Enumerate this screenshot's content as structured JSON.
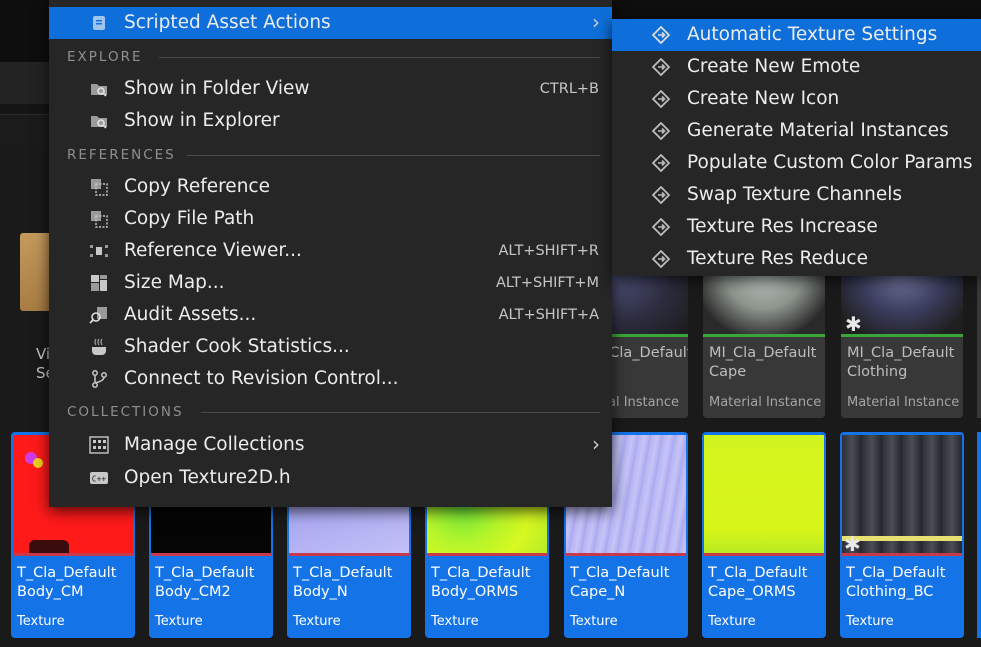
{
  "menu": {
    "scripted": {
      "label": "Scripted Asset Actions",
      "arrow": "›"
    },
    "sections": {
      "explore": "EXPLORE",
      "references": "REFERENCES",
      "collections": "COLLECTIONS"
    },
    "items": {
      "show_folder": {
        "label": "Show in Folder View",
        "shortcut": "CTRL+B"
      },
      "show_explorer": {
        "label": "Show in Explorer"
      },
      "copy_reference": {
        "label": "Copy Reference"
      },
      "copy_file_path": {
        "label": "Copy File Path"
      },
      "reference_viewer": {
        "label": "Reference Viewer...",
        "shortcut": "ALT+SHIFT+R"
      },
      "size_map": {
        "label": "Size Map...",
        "shortcut": "ALT+SHIFT+M"
      },
      "audit_assets": {
        "label": "Audit Assets...",
        "shortcut": "ALT+SHIFT+A"
      },
      "shader_cook": {
        "label": "Shader Cook Statistics..."
      },
      "revision_control": {
        "label": "Connect to Revision Control..."
      },
      "manage_collections": {
        "label": "Manage Collections",
        "arrow": "›"
      },
      "open_texture": {
        "label": "Open Texture2D.h"
      }
    }
  },
  "submenu": {
    "items": [
      "Automatic Texture Settings",
      "Create New Emote",
      "Create New Icon",
      "Generate Material Instances",
      "Populate Custom Color Params",
      "Swap Texture Channels",
      "Texture Res Increase",
      "Texture Res Reduce"
    ]
  },
  "browser": {
    "folder_label": "Vi\nSe",
    "material_tiles": [
      {
        "name": "_Cla_Default",
        "type": "al Instance"
      },
      {
        "name": "MI_Cla_Default\nCape",
        "type": "Material Instance"
      },
      {
        "name": "MI_Cla_Default\nClothing",
        "type": "Material Instance"
      }
    ],
    "texture_tiles": [
      {
        "name": "T_Cla_Default\nBody_CM",
        "type": "Texture"
      },
      {
        "name": "T_Cla_Default\nBody_CM2",
        "type": "Texture"
      },
      {
        "name": "T_Cla_Default\nBody_N",
        "type": "Texture"
      },
      {
        "name": "T_Cla_Default\nBody_ORMS",
        "type": "Texture"
      },
      {
        "name": "T_Cla_Default\nCape_N",
        "type": "Texture"
      },
      {
        "name": "T_Cla_Default\nCape_ORMS",
        "type": "Texture"
      },
      {
        "name": "T_Cla_Default\nClothing_BC",
        "type": "Texture"
      }
    ]
  },
  "colors": {
    "accent": "#0e6fda",
    "menu_bg": "#262626",
    "selected_tile": "#1473e6"
  }
}
